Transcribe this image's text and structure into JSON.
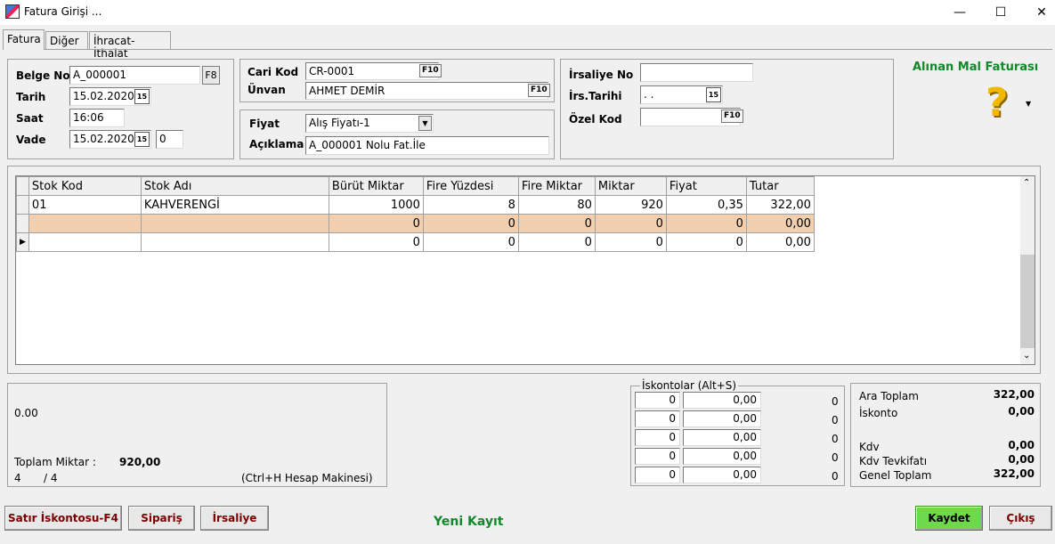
{
  "window": {
    "title": "Fatura Girişi ...",
    "minimize": "—",
    "maximize": "☐",
    "close": "✕"
  },
  "tabs": [
    "Fatura",
    "Diğer",
    "İhracat-İthalat"
  ],
  "left": {
    "belge_no_label": "Belge No",
    "belge_no": "A_000001",
    "belge_btn": "F8",
    "tarih_label": "Tarih",
    "tarih": "15.02.2020",
    "saat_label": "Saat",
    "saat": "16:06",
    "vade_label": "Vade",
    "vade": "15.02.2020",
    "vade_gun": "0",
    "cal": "15"
  },
  "cari": {
    "cari_kod_label": "Cari Kod",
    "cari_kod": "CR-0001",
    "unvan_label": "Ünvan",
    "unvan": "AHMET DEMİR",
    "f10": "F10"
  },
  "fiyat": {
    "fiyat_label": "Fiyat",
    "fiyat": "Alış Fiyatı-1",
    "aciklama_label": "Açıklama",
    "aciklama": "A_000001 Nolu Fat.İle"
  },
  "irsaliye": {
    "irsaliye_no_label": "İrsaliye No",
    "irsaliye_no": "",
    "irs_tarihi_label": "İrs.Tarihi",
    "irs_tarihi": " .  .",
    "ozel_kod_label": "Özel Kod",
    "ozel_kod": ""
  },
  "invoice_type": "Alınan Mal Faturası",
  "grid": {
    "columns": [
      "Stok Kod",
      "Stok Adı",
      "Bürüt Miktar",
      "Fire Yüzdesi",
      "Fire Miktar",
      "Miktar",
      "Fiyat",
      "Tutar"
    ],
    "rows": [
      [
        "01",
        "KAHVERENGİ",
        "1000",
        "8",
        "80",
        "920",
        "0,35",
        "322,00"
      ],
      [
        "",
        "",
        "0",
        "0",
        "0",
        "0",
        "0",
        "0,00"
      ],
      [
        "",
        "",
        "0",
        "0",
        "0",
        "0",
        "0",
        "0,00"
      ]
    ]
  },
  "summary": {
    "value": "0.00",
    "toplam_label": "Toplam Miktar :",
    "toplam": "920,00",
    "rec": "4",
    "rec_total": "/ 4",
    "hint": "(Ctrl+H Hesap Makinesi)"
  },
  "iskonto": {
    "legend": "İskontolar (Alt+S)",
    "rows": [
      [
        "0",
        "0,00",
        "0"
      ],
      [
        "0",
        "0,00",
        "0"
      ],
      [
        "0",
        "0,00",
        "0"
      ],
      [
        "0",
        "0,00",
        "0"
      ],
      [
        "0",
        "0,00",
        "0"
      ]
    ]
  },
  "totals": {
    "ara_label": "Ara Toplam",
    "ara": "322,00",
    "iskonto_label": "İskonto",
    "iskonto": "0,00",
    "kdv_label": "Kdv",
    "kdv": "0,00",
    "tevk_label": "Kdv Tevkifatı",
    "tevk": "0,00",
    "genel_label": "Genel Toplam",
    "genel": "322,00"
  },
  "buttons": {
    "satir": "Satır İskontosu-F4",
    "siparis": "Sipariş",
    "irsaliye": "İrsaliye",
    "kaydet": "Kaydet",
    "cikis": "Çıkış"
  },
  "status": "Yeni Kayıt"
}
